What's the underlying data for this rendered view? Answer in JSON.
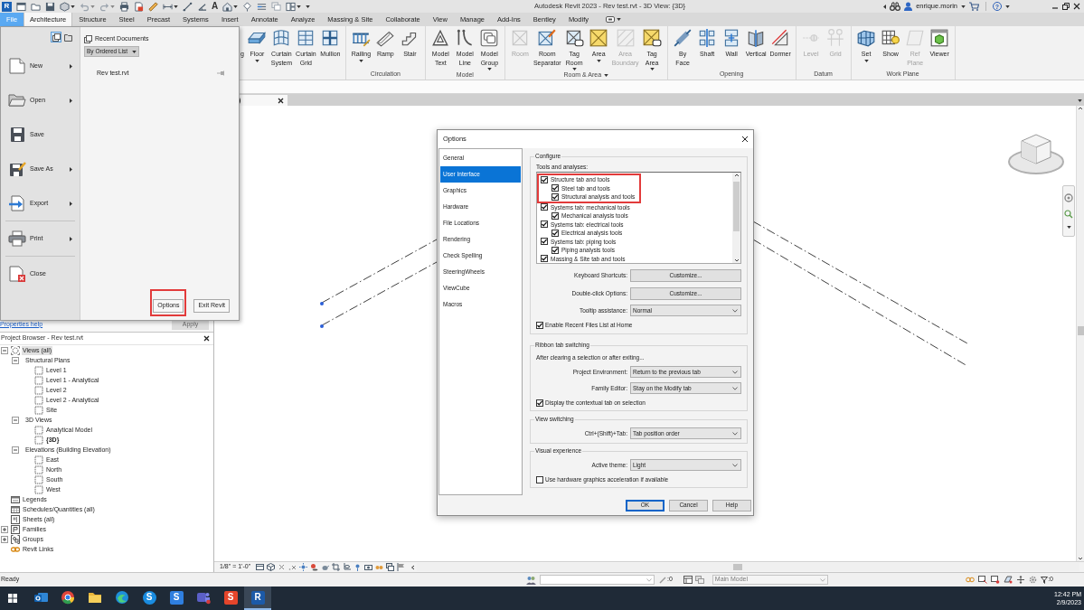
{
  "title_bar": {
    "app_badge": "R",
    "text_tool_glyph": "A",
    "title": "Autodesk Revit 2023 - Rev test.rvt - 3D View: {3D}",
    "user": "enrique.morin",
    "help_glyph": "?"
  },
  "file_button": {
    "label": "File",
    "open": true
  },
  "tabs": [
    {
      "label": "Architecture",
      "selected": true
    },
    {
      "label": "Structure",
      "selected": false
    },
    {
      "label": "Steel",
      "selected": false
    },
    {
      "label": "Precast",
      "selected": false
    },
    {
      "label": "Systems",
      "selected": false
    },
    {
      "label": "Insert",
      "selected": false
    },
    {
      "label": "Annotate",
      "selected": false
    },
    {
      "label": "Analyze",
      "selected": false
    },
    {
      "label": "Massing & Site",
      "selected": false
    },
    {
      "label": "Collaborate",
      "selected": false
    },
    {
      "label": "View",
      "selected": false
    },
    {
      "label": "Manage",
      "selected": false
    },
    {
      "label": "Add-Ins",
      "selected": false
    },
    {
      "label": "Bentley",
      "selected": false
    },
    {
      "label": "Modify",
      "selected": false
    }
  ],
  "ribbon": {
    "panels": [
      {
        "tools": [
          {
            "label": "g",
            "dropdown": false,
            "disabled": false
          },
          {
            "label": "Floor",
            "dropdown": true,
            "disabled": false
          },
          {
            "label": "Curtain System",
            "dropdown": false,
            "disabled": false
          },
          {
            "label": "Curtain Grid",
            "dropdown": false,
            "disabled": false
          },
          {
            "label": "Mullion",
            "dropdown": false,
            "disabled": false
          }
        ]
      },
      {
        "label": "Circulation",
        "menu": false,
        "tools": [
          {
            "label": "Railing",
            "dropdown": true,
            "disabled": false
          },
          {
            "label": "Ramp",
            "dropdown": false,
            "disabled": false
          },
          {
            "label": "Stair",
            "dropdown": false,
            "disabled": false
          }
        ]
      },
      {
        "label": "Model",
        "menu": false,
        "tools": [
          {
            "label": "Model Text",
            "dropdown": false,
            "disabled": false
          },
          {
            "label": "Model Line",
            "dropdown": false,
            "disabled": false
          },
          {
            "label": "Model Group",
            "dropdown": true,
            "disabled": false
          }
        ]
      },
      {
        "label": "Room & Area",
        "menu": true,
        "tools": [
          {
            "label": "Room",
            "dropdown": false,
            "disabled": true
          },
          {
            "label": "Room Separator",
            "dropdown": false,
            "disabled": false
          },
          {
            "label": "Tag Room",
            "dropdown": true,
            "disabled": false
          },
          {
            "label": "Area",
            "dropdown": true,
            "disabled": false
          },
          {
            "label": "Area Boundary",
            "dropdown": false,
            "disabled": true
          },
          {
            "label": "Tag Area",
            "dropdown": true,
            "disabled": false
          }
        ]
      },
      {
        "label": "Opening",
        "menu": false,
        "tools": [
          {
            "label": "By Face",
            "dropdown": false,
            "disabled": false
          },
          {
            "label": "Shaft",
            "dropdown": false,
            "disabled": false
          },
          {
            "label": "Wall",
            "dropdown": false,
            "disabled": false
          },
          {
            "label": "Vertical",
            "dropdown": false,
            "disabled": false
          },
          {
            "label": "Dormer",
            "dropdown": false,
            "disabled": false
          }
        ]
      },
      {
        "label": "Datum",
        "menu": false,
        "tools": [
          {
            "label": "Level",
            "dropdown": false,
            "disabled": true
          },
          {
            "label": "Grid",
            "dropdown": false,
            "disabled": true
          }
        ]
      },
      {
        "label": "Work Plane",
        "menu": false,
        "tools": [
          {
            "label": "Set",
            "dropdown": true,
            "disabled": false
          },
          {
            "label": "Show",
            "dropdown": false,
            "disabled": false
          },
          {
            "label": "Ref Plane",
            "dropdown": false,
            "disabled": true
          },
          {
            "label": "Viewer",
            "dropdown": false,
            "disabled": false
          }
        ]
      }
    ]
  },
  "file_menu": {
    "view_modes": [
      {
        "selected": true
      },
      {
        "selected": false
      }
    ],
    "groups": [
      [
        {
          "label": "New",
          "submenu": true
        },
        {
          "label": "Open",
          "submenu": true
        },
        {
          "label": "Save",
          "submenu": false
        },
        {
          "label": "Save As",
          "submenu": true
        },
        {
          "label": "Export",
          "submenu": true
        }
      ],
      [
        {
          "label": "Print",
          "submenu": true
        }
      ],
      [
        {
          "label": "Close",
          "submenu": false
        }
      ]
    ],
    "recent_title": "Recent Documents",
    "sort": "By Ordered List",
    "recent": [
      {
        "name": "Rev test.rvt",
        "pinned": false
      }
    ],
    "buttons": [
      {
        "label": "Options",
        "highlighted": true
      },
      {
        "label": "Exit Revit",
        "highlighted": false
      }
    ]
  },
  "properties": {
    "help_link": "Properties help",
    "apply": {
      "label": "Apply",
      "disabled": true
    }
  },
  "project_browser": {
    "title": "Project Browser - Rev test.rvt",
    "tree": [
      {
        "label": "Views (all)",
        "selected": true,
        "current": false,
        "expanded": true,
        "children": [
          {
            "label": "Structural Plans",
            "selected": false,
            "current": false,
            "expanded": true,
            "children": [
              {
                "label": "Level 1",
                "selected": false,
                "current": false
              },
              {
                "label": "Level 1 - Analytical",
                "selected": false,
                "current": false
              },
              {
                "label": "Level 2",
                "selected": false,
                "current": false
              },
              {
                "label": "Level 2 - Analytical",
                "selected": false,
                "current": false
              },
              {
                "label": "Site",
                "selected": false,
                "current": false
              }
            ]
          },
          {
            "label": "3D Views",
            "selected": false,
            "current": false,
            "expanded": true,
            "children": [
              {
                "label": "Analytical Model",
                "selected": false,
                "current": false
              },
              {
                "label": "{3D}",
                "selected": false,
                "current": true
              }
            ]
          },
          {
            "label": "Elevations (Building Elevation)",
            "selected": false,
            "current": false,
            "expanded": true,
            "children": [
              {
                "label": "East",
                "selected": false,
                "current": false
              },
              {
                "label": "North",
                "selected": false,
                "current": false
              },
              {
                "label": "South",
                "selected": false,
                "current": false
              },
              {
                "label": "West",
                "selected": false,
                "current": false
              }
            ]
          }
        ]
      },
      {
        "label": "Legends",
        "selected": false,
        "current": false
      },
      {
        "label": "Schedules/Quantities (all)",
        "selected": false,
        "current": false
      },
      {
        "label": "Sheets (all)",
        "selected": false,
        "current": false
      },
      {
        "label": "Families",
        "selected": false,
        "current": false,
        "expanded": false
      },
      {
        "label": "Groups",
        "selected": false,
        "current": false,
        "expanded": false
      },
      {
        "label": "Revit Links",
        "selected": false,
        "current": false
      }
    ]
  },
  "view_tabs": [
    {
      "label": ")"
    }
  ],
  "view_control": {
    "scale": "1/8\" = 1'-0\""
  },
  "options_dialog": {
    "title": "Options",
    "nav": [
      {
        "label": "General",
        "selected": false
      },
      {
        "label": "User Interface",
        "selected": true
      },
      {
        "label": "Graphics",
        "selected": false
      },
      {
        "label": "Hardware",
        "selected": false
      },
      {
        "label": "File Locations",
        "selected": false
      },
      {
        "label": "Rendering",
        "selected": false
      },
      {
        "label": "Check Spelling",
        "selected": false
      },
      {
        "label": "SteeringWheels",
        "selected": false
      },
      {
        "label": "ViewCube",
        "selected": false
      },
      {
        "label": "Macros",
        "selected": false
      }
    ],
    "groups": [
      {
        "legend": "Configure",
        "list_label": "Tools and analyses:",
        "tools": [
          {
            "label": "Structure tab and tools",
            "checked": true,
            "highlighted": true,
            "children": [
              {
                "label": "Steel tab and tools",
                "checked": true
              },
              {
                "label": "Structural analysis and tools",
                "checked": true
              }
            ]
          },
          {
            "label": "Systems tab: mechanical tools",
            "checked": true,
            "highlighted": false,
            "children": [
              {
                "label": "Mechanical analysis tools",
                "checked": true
              }
            ]
          },
          {
            "label": "Systems tab: electrical tools",
            "checked": true,
            "highlighted": false,
            "children": [
              {
                "label": "Electrical analysis tools",
                "checked": true
              }
            ]
          },
          {
            "label": "Systems tab: piping tools",
            "checked": true,
            "highlighted": false,
            "children": [
              {
                "label": "Piping analysis tools",
                "checked": true
              }
            ]
          },
          {
            "label": "Massing & Site tab and tools",
            "checked": true,
            "highlighted": false
          }
        ],
        "rows": [
          {
            "kind": "button",
            "label": "Keyboard Shortcuts:",
            "value": "Customize..."
          },
          {
            "kind": "button",
            "label": "Double-click Options:",
            "value": "Customize..."
          },
          {
            "kind": "select",
            "label": "Tooltip assistance:",
            "value": "Normal"
          },
          {
            "kind": "checkbox",
            "label": "Enable Recent Files List at Home",
            "checked": true
          }
        ]
      },
      {
        "legend": "Ribbon tab switching",
        "rows": [
          {
            "kind": "note",
            "label": "After clearing a selection or after exiting..."
          },
          {
            "kind": "select",
            "label": "Project Environment:",
            "value": "Return to the previous tab"
          },
          {
            "kind": "select",
            "label": "Family Editor:",
            "value": "Stay on the Modify tab"
          },
          {
            "kind": "checkbox",
            "label": "Display the contextual tab on selection",
            "checked": true
          }
        ]
      },
      {
        "legend": "View switching",
        "rows": [
          {
            "kind": "select",
            "label": "Ctrl+(Shift)+Tab:",
            "value": "Tab position order"
          }
        ]
      },
      {
        "legend": "Visual experience",
        "rows": [
          {
            "kind": "select",
            "label": "Active theme:",
            "value": "Light"
          },
          {
            "kind": "checkbox",
            "label": "Use hardware graphics acceleration if available",
            "checked": false
          }
        ]
      }
    ],
    "buttons": [
      {
        "label": "OK",
        "default": true
      },
      {
        "label": "Cancel",
        "default": false
      },
      {
        "label": "Help",
        "default": false
      }
    ]
  },
  "status_bar": {
    "message": "Ready",
    "editable_count": ":0",
    "model": {
      "value": "Main Model",
      "disabled": true
    },
    "filter_count": ":0"
  },
  "taskbar": {
    "apps": [
      {
        "active": false
      },
      {
        "active": false
      },
      {
        "active": false
      },
      {
        "active": false
      },
      {
        "glyph": "S",
        "active": false
      },
      {
        "glyph": "S",
        "active": false
      },
      {
        "active": false
      },
      {
        "glyph": "S",
        "active": false
      },
      {
        "glyph": "R",
        "active": true
      }
    ],
    "time": "12:42 PM",
    "date": "2/9/2023"
  }
}
